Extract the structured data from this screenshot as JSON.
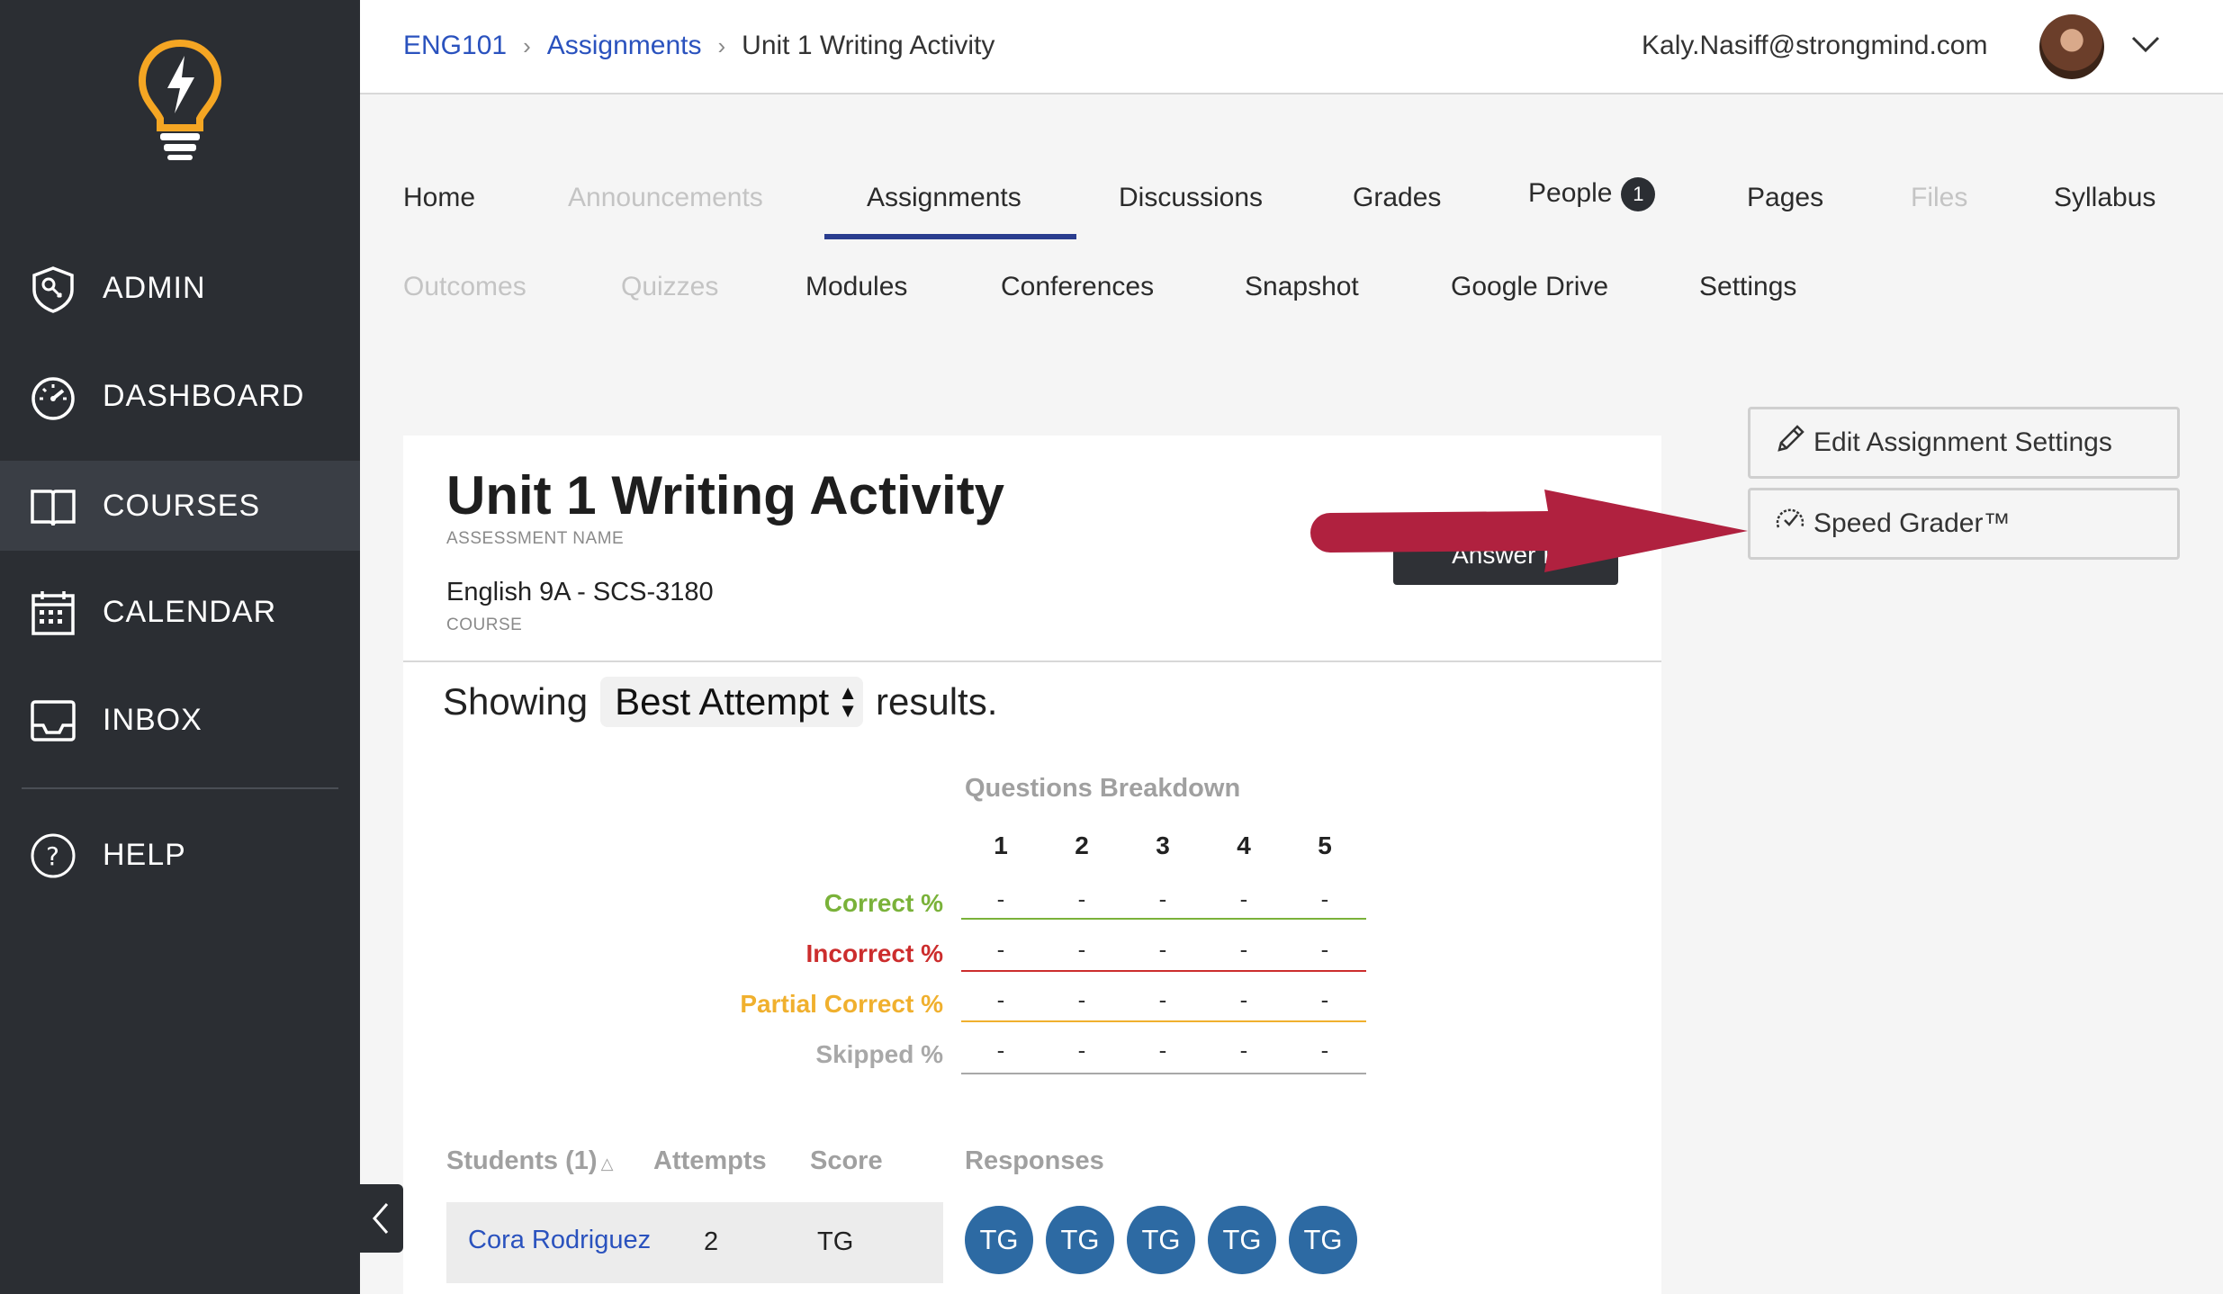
{
  "sidebar": {
    "items": [
      {
        "label": "ADMIN",
        "icon": "admin-shield-icon"
      },
      {
        "label": "DASHBOARD",
        "icon": "dashboard-gauge-icon"
      },
      {
        "label": "COURSES",
        "icon": "book-icon",
        "active": true
      },
      {
        "label": "CALENDAR",
        "icon": "calendar-icon"
      },
      {
        "label": "INBOX",
        "icon": "inbox-icon"
      },
      {
        "label": "HELP",
        "icon": "help-circle-icon"
      }
    ]
  },
  "header": {
    "breadcrumb": [
      "ENG101",
      "Assignments",
      "Unit 1 Writing Activity"
    ],
    "user_email": "Kaly.Nasiff@strongmind.com"
  },
  "tabs": {
    "row1": [
      {
        "label": "Home",
        "enabled": true
      },
      {
        "label": "Announcements",
        "enabled": false
      },
      {
        "label": "Assignments",
        "enabled": true,
        "active": true
      },
      {
        "label": "Discussions",
        "enabled": true
      },
      {
        "label": "Grades",
        "enabled": true
      },
      {
        "label": "People",
        "enabled": true,
        "badge": "1"
      },
      {
        "label": "Pages",
        "enabled": true
      },
      {
        "label": "Files",
        "enabled": false
      },
      {
        "label": "Syllabus",
        "enabled": true
      }
    ],
    "row2": [
      {
        "label": "Outcomes",
        "enabled": false
      },
      {
        "label": "Quizzes",
        "enabled": false
      },
      {
        "label": "Modules",
        "enabled": true
      },
      {
        "label": "Conferences",
        "enabled": true
      },
      {
        "label": "Snapshot",
        "enabled": true
      },
      {
        "label": "Google Drive",
        "enabled": true
      },
      {
        "label": "Settings",
        "enabled": true
      }
    ]
  },
  "assessment": {
    "title": "Unit 1 Writing Activity",
    "title_label": "ASSESSMENT NAME",
    "course": "English 9A - SCS-3180",
    "course_label": "COURSE",
    "answer_button": "Answer K"
  },
  "results": {
    "showing_prefix": "Showing",
    "attempt_selected": "Best Attempt",
    "showing_suffix": "results."
  },
  "breakdown": {
    "title": "Questions Breakdown",
    "questions": [
      "1",
      "2",
      "3",
      "4",
      "5"
    ],
    "rows": [
      {
        "label": "Correct %",
        "color": "#7ab23a",
        "values": [
          "-",
          "-",
          "-",
          "-",
          "-"
        ]
      },
      {
        "label": "Incorrect %",
        "color": "#cc2d2d",
        "values": [
          "-",
          "-",
          "-",
          "-",
          "-"
        ]
      },
      {
        "label": "Partial Correct %",
        "color": "#f0b02e",
        "values": [
          "-",
          "-",
          "-",
          "-",
          "-"
        ]
      },
      {
        "label": "Skipped %",
        "color": "#a8a8a8",
        "values": [
          "-",
          "-",
          "-",
          "-",
          "-"
        ]
      }
    ]
  },
  "students_table": {
    "headers": {
      "students": "Students (1)",
      "attempts": "Attempts",
      "score": "Score",
      "responses": "Responses"
    },
    "rows": [
      {
        "name": "Cora Rodriguez",
        "attempts": "2",
        "score": "TG",
        "responses": [
          "TG",
          "TG",
          "TG",
          "TG",
          "TG"
        ]
      }
    ]
  },
  "side_buttons": {
    "edit": "Edit Assignment Settings",
    "speed": "Speed Grader™"
  },
  "colors": {
    "sidebar_bg": "#2b2e33",
    "link": "#2a52be",
    "active_tab": "#2a3d8f",
    "response_circle": "#2d6aa3",
    "annotation_arrow": "#b0213f"
  }
}
